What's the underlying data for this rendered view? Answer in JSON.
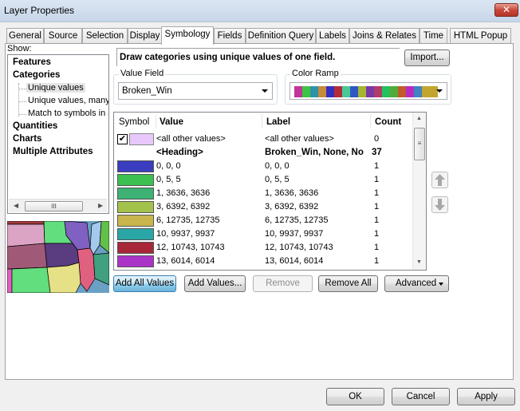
{
  "window": {
    "title": "Layer Properties",
    "close_label": "✕"
  },
  "tabs": [
    {
      "label": "General"
    },
    {
      "label": "Source"
    },
    {
      "label": "Selection"
    },
    {
      "label": "Display"
    },
    {
      "label": "Symbology",
      "active": true
    },
    {
      "label": "Fields"
    },
    {
      "label": "Definition Query"
    },
    {
      "label": "Labels"
    },
    {
      "label": "Joins & Relates"
    },
    {
      "label": "Time"
    },
    {
      "label": "HTML Popup"
    }
  ],
  "show": {
    "label": "Show:",
    "tree": [
      {
        "label": "Features",
        "level": 0
      },
      {
        "label": "Categories",
        "level": 0
      },
      {
        "label": "Unique values",
        "level": 1,
        "selected": true
      },
      {
        "label": "Unique values, many",
        "level": 1
      },
      {
        "label": "Match to symbols in a",
        "level": 1
      },
      {
        "label": "Quantities",
        "level": 0
      },
      {
        "label": "Charts",
        "level": 0
      },
      {
        "label": "Multiple Attributes",
        "level": 0
      }
    ],
    "scroll_thumb_glyph": "III"
  },
  "description": "Draw categories using unique values of one field.",
  "import_label": "Import...",
  "value_field": {
    "legend": "Value Field",
    "selected": "Broken_Win"
  },
  "color_ramp": {
    "legend": "Color Ramp",
    "colors": [
      "#c0369b",
      "#3ec444",
      "#2e93a8",
      "#c78a3a",
      "#3430bd",
      "#b42c38",
      "#49c996",
      "#3056c2",
      "#a6b532",
      "#7a39a3",
      "#b03c6a",
      "#25c05d",
      "#52ab3a",
      "#c05a2c",
      "#b62cc2",
      "#4083c1",
      "#c2a52e",
      "#c2a52e"
    ]
  },
  "grid": {
    "headers": {
      "symbol": "Symbol",
      "value": "Value",
      "label": "Label",
      "count": "Count"
    },
    "other_row": {
      "checked": true,
      "check_glyph": "✔",
      "color": "#e8c8fa",
      "value": "<all other values>",
      "label": "<all other values>",
      "count": "0"
    },
    "heading_row": {
      "value": "<Heading>",
      "label": "Broken_Win, None, No",
      "count": "37"
    },
    "rows": [
      {
        "color": "#3a3dbf",
        "value": "0, 0, 0",
        "label": "0, 0, 0",
        "count": "1"
      },
      {
        "color": "#3cc050",
        "value": "0, 5, 5",
        "label": "0, 5, 5",
        "count": "1"
      },
      {
        "color": "#3db274",
        "value": "1, 3636, 3636",
        "label": "1, 3636, 3636",
        "count": "1"
      },
      {
        "color": "#a3c24c",
        "value": "3, 6392, 6392",
        "label": "3, 6392, 6392",
        "count": "1"
      },
      {
        "color": "#c8b54c",
        "value": "6, 12735, 12735",
        "label": "6, 12735, 12735",
        "count": "1"
      },
      {
        "color": "#2aa6a6",
        "value": "10, 9937, 9937",
        "label": "10, 9937, 9937",
        "count": "1"
      },
      {
        "color": "#a8283a",
        "value": "12, 10743, 10743",
        "label": "12, 10743, 10743",
        "count": "1"
      },
      {
        "color": "#ab34c8",
        "value": "13, 6014, 6014",
        "label": "13, 6014, 6014",
        "count": "1"
      }
    ]
  },
  "action_buttons": {
    "add_all": "Add All Values",
    "add_values": "Add Values...",
    "remove": "Remove",
    "remove_all": "Remove All",
    "advanced": "Advanced"
  },
  "footer": {
    "ok": "OK",
    "cancel": "Cancel",
    "apply": "Apply"
  }
}
